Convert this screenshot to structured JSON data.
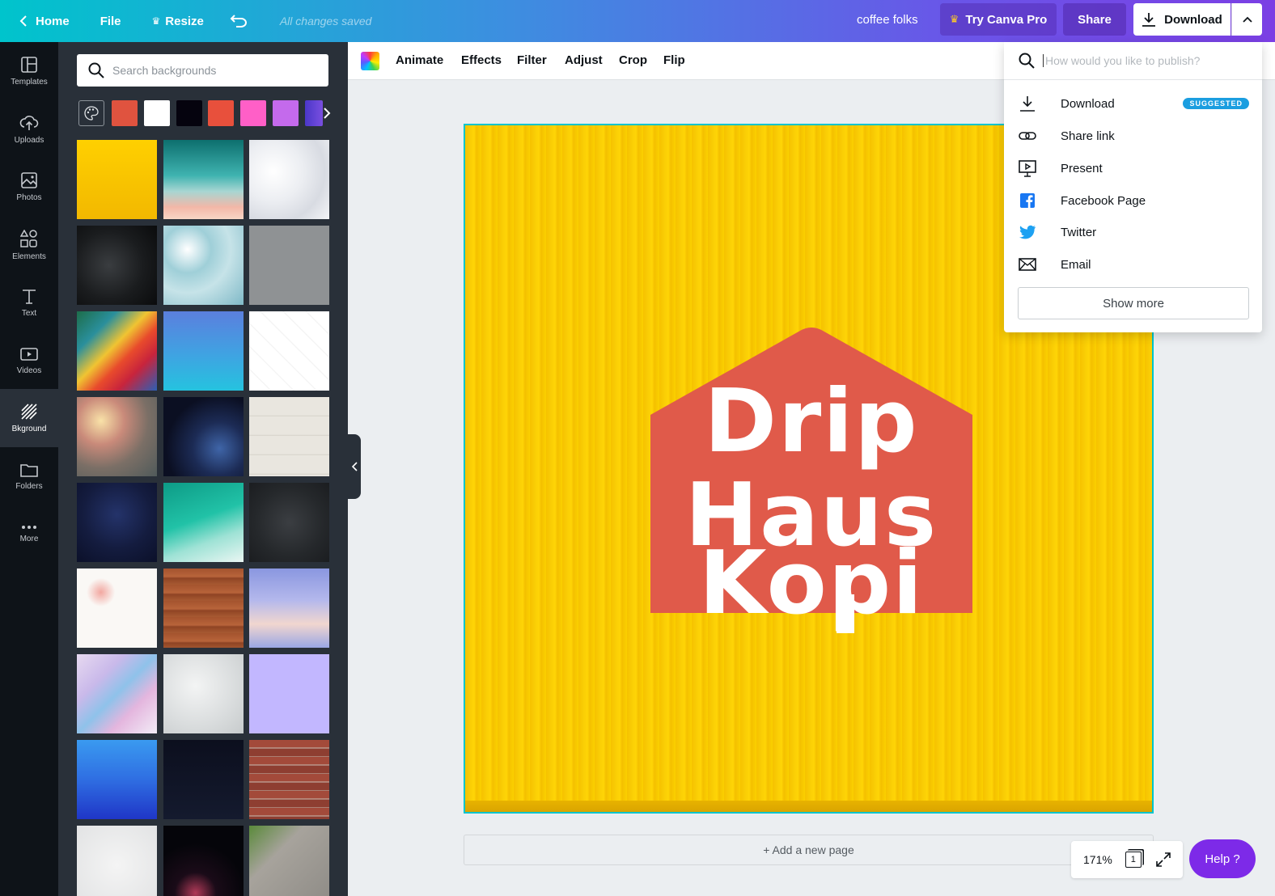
{
  "topbar": {
    "home": "Home",
    "file": "File",
    "resize": "Resize",
    "saved": "All changes saved",
    "design_name": "coffee folks",
    "try_pro": "Try Canva Pro",
    "share": "Share",
    "download": "Download"
  },
  "rail": [
    {
      "label": "Templates",
      "icon": "templates-icon"
    },
    {
      "label": "Uploads",
      "icon": "upload-cloud-icon"
    },
    {
      "label": "Photos",
      "icon": "photo-icon"
    },
    {
      "label": "Elements",
      "icon": "shapes-icon"
    },
    {
      "label": "Text",
      "icon": "text-icon"
    },
    {
      "label": "Videos",
      "icon": "video-icon"
    },
    {
      "label": "Bkground",
      "icon": "background-icon",
      "active": true
    },
    {
      "label": "Folders",
      "icon": "folder-icon"
    },
    {
      "label": "More",
      "icon": "more-dots-icon"
    }
  ],
  "panel": {
    "search_placeholder": "Search backgrounds",
    "swatches": [
      "#e0533f",
      "#ffffff",
      "#05030e",
      "#e8503c",
      "#ff5fc7",
      "#c46aec",
      "#6a3fd8"
    ],
    "thumb_count": 27
  },
  "canvas_toolbar": {
    "animate": "Animate",
    "effects": "Effects",
    "filter": "Filter",
    "adjust": "Adjust",
    "crop": "Crop",
    "flip": "Flip"
  },
  "design": {
    "line1": "Drip",
    "line2": "Haus",
    "line3": "Kopi",
    "bg_color": "#ffd000",
    "house_color": "#e05a4a"
  },
  "add_page": "+ Add a new page",
  "zoom": {
    "level": "171%",
    "page_number": "1"
  },
  "help": "Help  ?",
  "publish": {
    "search_placeholder": "How would you like to publish?",
    "items": [
      {
        "label": "Download",
        "icon": "download-icon",
        "badge": "SUGGESTED"
      },
      {
        "label": "Share link",
        "icon": "link-icon"
      },
      {
        "label": "Present",
        "icon": "present-icon"
      },
      {
        "label": "Facebook Page",
        "icon": "facebook-icon"
      },
      {
        "label": "Twitter",
        "icon": "twitter-icon"
      },
      {
        "label": "Email",
        "icon": "email-icon"
      }
    ],
    "show_more": "Show more"
  }
}
